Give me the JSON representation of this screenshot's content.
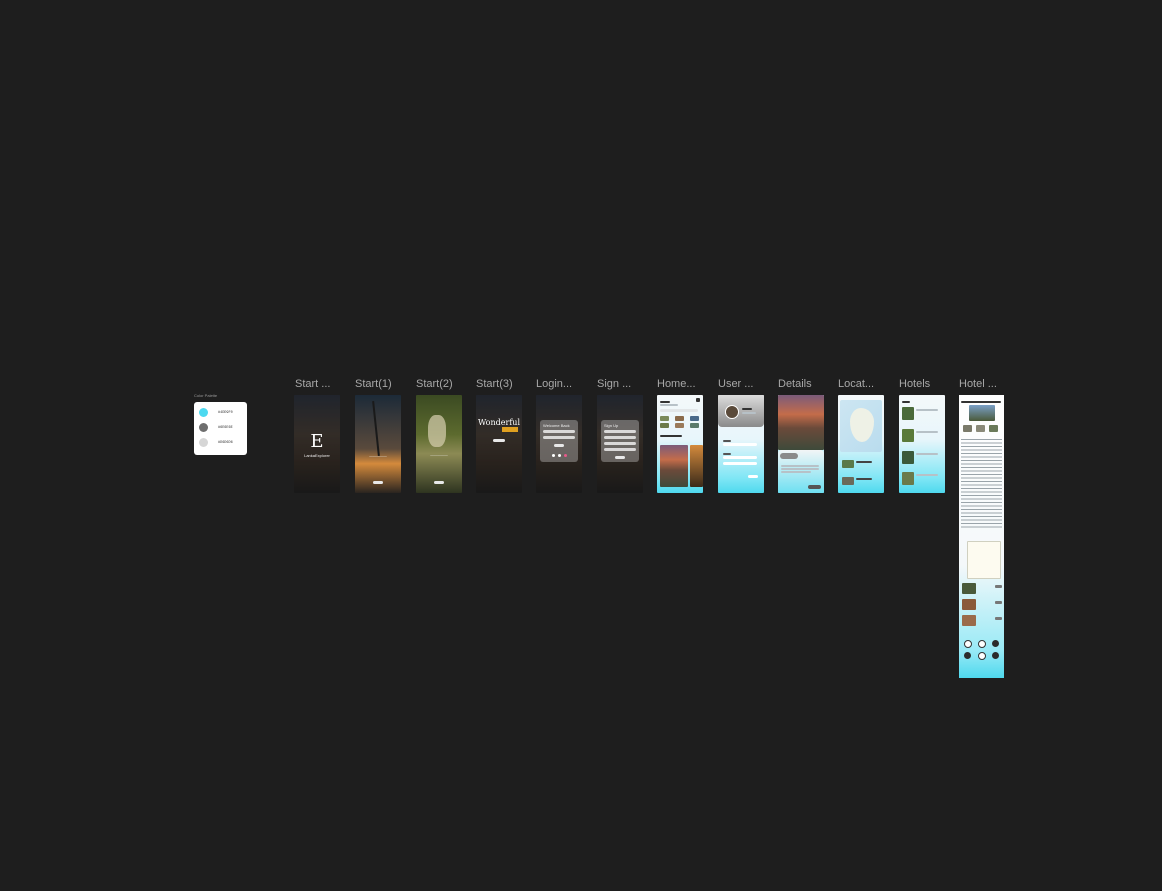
{
  "palette": {
    "title": "Color Palette",
    "swatches": [
      {
        "color": "#4dd9f0",
        "label": "#4DD9F0"
      },
      {
        "color": "#6e6e6e",
        "label": "#6E6E6E"
      },
      {
        "color": "#d6d6d6",
        "label": "#D6D6D6"
      }
    ]
  },
  "frames": [
    {
      "label": "Start ..."
    },
    {
      "label": "Start(1)"
    },
    {
      "label": "Start(2)"
    },
    {
      "label": "Start(3)"
    },
    {
      "label": "Login..."
    },
    {
      "label": "Sign ..."
    },
    {
      "label": "Home..."
    },
    {
      "label": "User ..."
    },
    {
      "label": "Details"
    },
    {
      "label": "Locat..."
    },
    {
      "label": "Hotels"
    },
    {
      "label": "Hotel ..."
    }
  ],
  "screens": {
    "start0_brand": "LankaExplorer",
    "start3_title": "Wonderful",
    "login_title": "Welcome Back",
    "signup_title": "Sign Up"
  },
  "colors": {
    "canvas": "#1e1e1e",
    "accent": "#4dd9f0",
    "label": "#a8a8a8"
  }
}
